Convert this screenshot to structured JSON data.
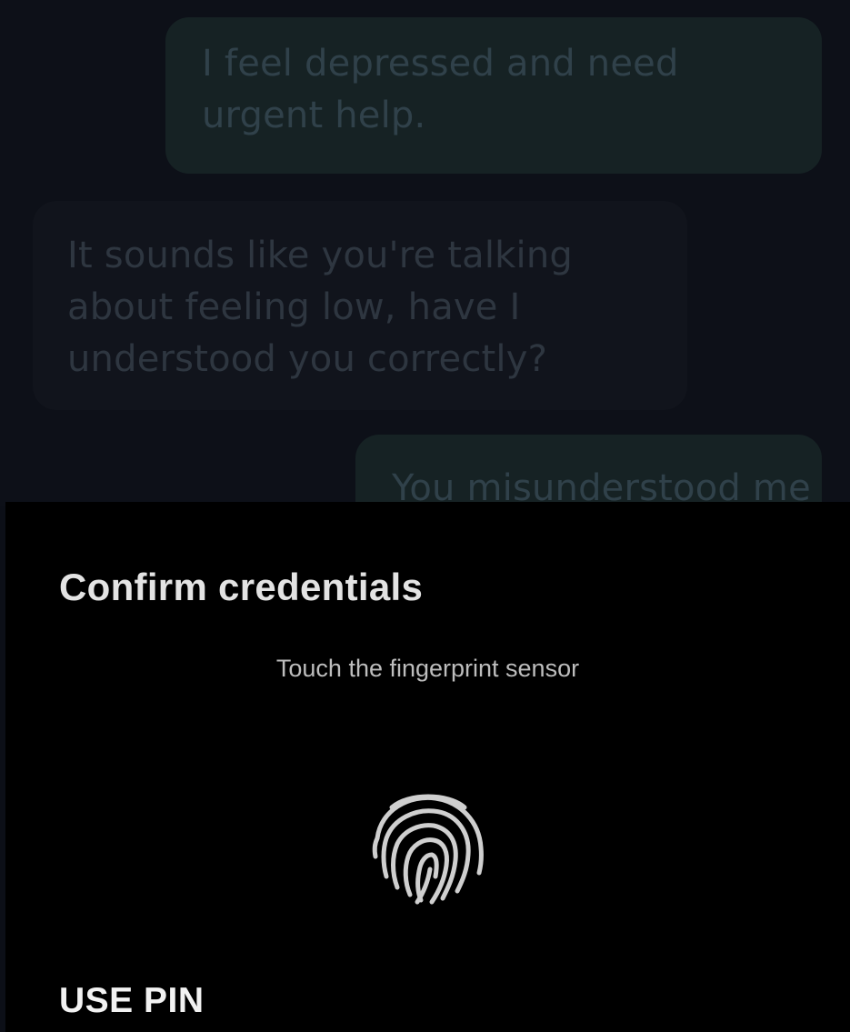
{
  "chat": {
    "messages": [
      {
        "from": "user",
        "text": "I feel depressed and need urgent help."
      },
      {
        "from": "bot",
        "text": "It sounds like you're talking about feeling low, have I understood you correctly?"
      },
      {
        "from": "user",
        "text": "You misunderstood me"
      }
    ]
  },
  "dialog": {
    "title": "Confirm credentials",
    "subtitle": "Touch the fingerprint sensor",
    "icon": "fingerprint-icon",
    "use_pin_label": "USE PIN"
  },
  "colors": {
    "chat_background": "#0d1018",
    "user_bubble": "#162224",
    "bot_bubble": "#11141c",
    "sheet_background": "#000000",
    "text_primary": "#e3e3e3",
    "text_secondary": "#bdbdbd"
  }
}
